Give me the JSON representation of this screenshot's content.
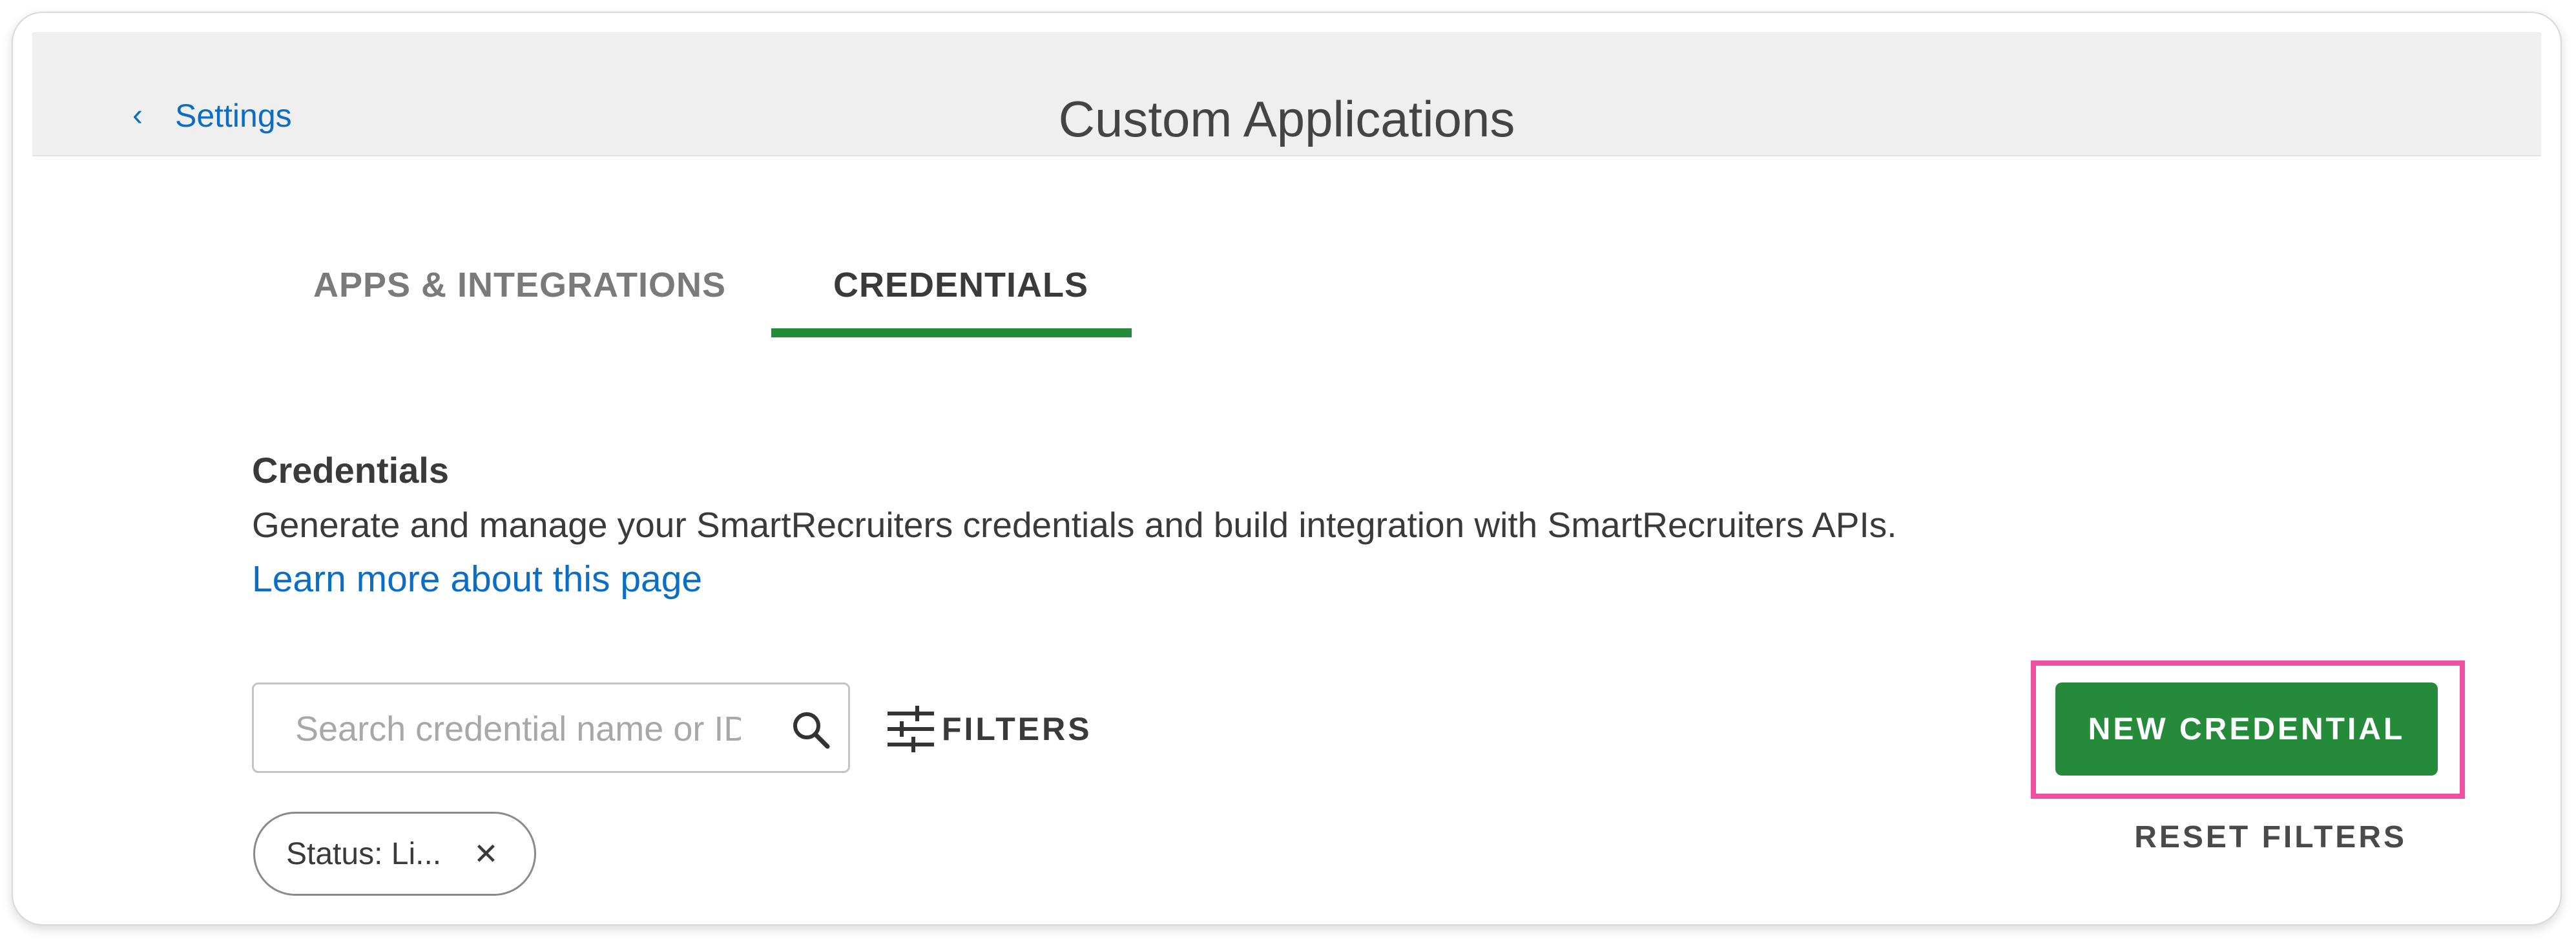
{
  "header": {
    "back_label": "Settings",
    "back_icon": "chevron-left-icon",
    "title": "Custom Applications"
  },
  "tabs": [
    {
      "label": "APPS & INTEGRATIONS",
      "active": false
    },
    {
      "label": "CREDENTIALS",
      "active": true
    }
  ],
  "section": {
    "title": "Credentials",
    "description": "Generate and manage your SmartRecruiters credentials and build integration with SmartRecruiters APIs.",
    "learn_more": "Learn more about this page"
  },
  "search": {
    "placeholder": "Search credential name or ID",
    "value": "",
    "icon": "search-icon"
  },
  "filters": {
    "label": "FILTERS",
    "icon": "sliders-icon"
  },
  "actions": {
    "new_credential": "NEW CREDENTIAL",
    "reset_filters": "RESET FILTERS"
  },
  "chips": [
    {
      "label": "Status: Li...",
      "close": "✕"
    }
  ],
  "colors": {
    "accent_green": "#258a3a",
    "link_blue": "#0a6ec7",
    "highlight_pink": "#ee4fa1",
    "header_bg": "#efefef"
  }
}
